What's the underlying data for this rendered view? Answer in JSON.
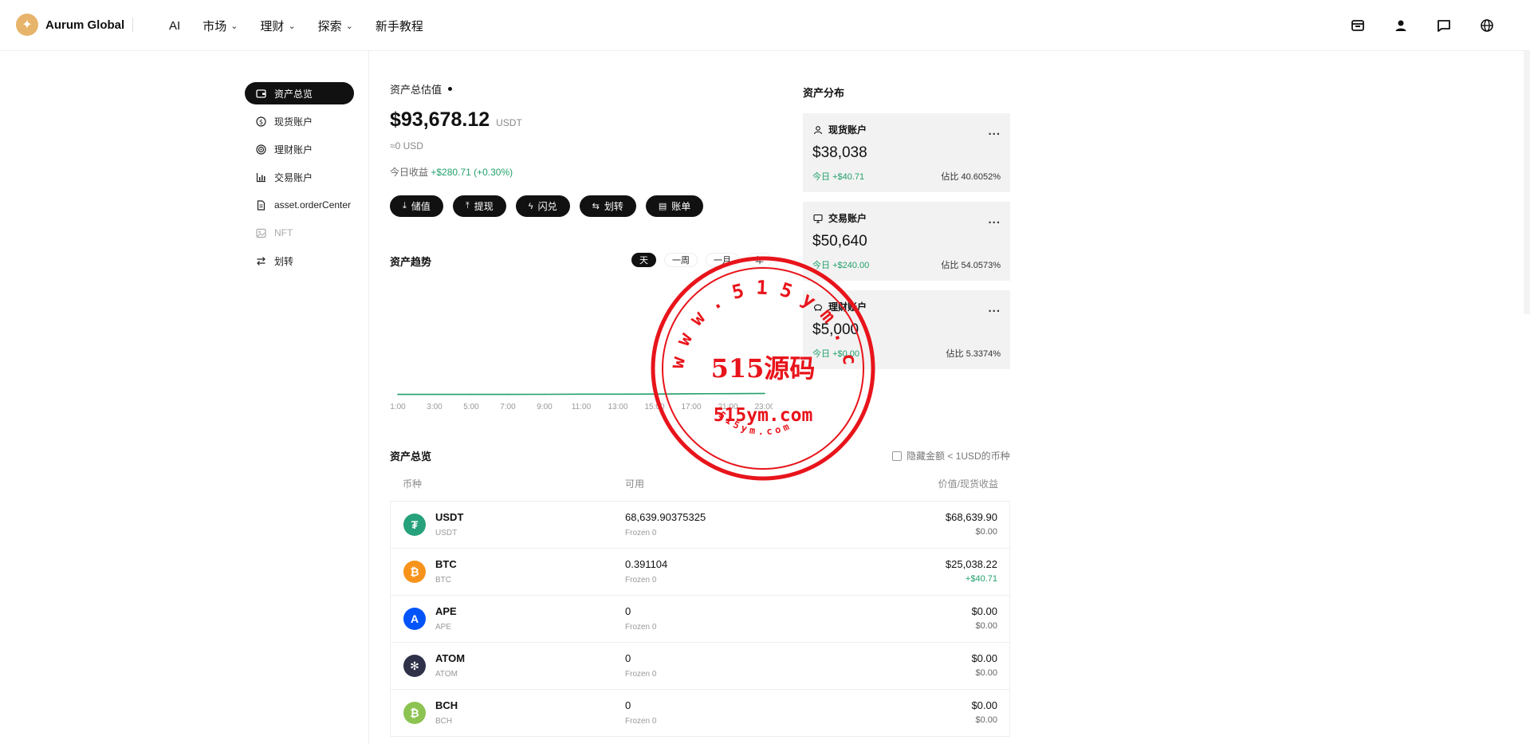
{
  "header": {
    "brand": "Aurum Global",
    "nav": [
      {
        "label": "AI",
        "dropdown": false
      },
      {
        "label": "市场",
        "dropdown": true
      },
      {
        "label": "理财",
        "dropdown": true
      },
      {
        "label": "探索",
        "dropdown": true
      },
      {
        "label": "新手教程",
        "dropdown": false
      }
    ],
    "icons": [
      "wallet-icon",
      "user-icon",
      "message-icon",
      "globe-icon"
    ]
  },
  "sidebar": {
    "items": [
      {
        "label": "资产总览",
        "icon": "wallet-icon",
        "state": "active"
      },
      {
        "label": "现货账户",
        "icon": "dollar-icon",
        "state": "normal"
      },
      {
        "label": "理财账户",
        "icon": "target-icon",
        "state": "normal"
      },
      {
        "label": "交易账户",
        "icon": "bar-chart-icon",
        "state": "normal"
      },
      {
        "label": "asset.orderCenter",
        "icon": "document-icon",
        "state": "normal"
      },
      {
        "label": "NFT",
        "icon": "image-icon",
        "state": "disabled"
      },
      {
        "label": "划转",
        "icon": "transfer-icon",
        "state": "normal"
      }
    ]
  },
  "summary": {
    "label": "资产总估值",
    "total": "$93,678.12",
    "unit": "USDT",
    "approx": "≈0 USD",
    "pnl_label": "今日收益",
    "pnl_value": "+$280.71",
    "pnl_percent": "(+0.30%)"
  },
  "actions": [
    {
      "label": "储值",
      "icon": "download-icon",
      "glyph": "⤓"
    },
    {
      "label": "提现",
      "icon": "upload-icon",
      "glyph": "⤒"
    },
    {
      "label": "闪兑",
      "icon": "flash-icon",
      "glyph": "ϟ"
    },
    {
      "label": "划转",
      "icon": "transfer-icon",
      "glyph": "⇆"
    },
    {
      "label": "账单",
      "icon": "bill-icon",
      "glyph": "▤"
    }
  ],
  "trend": {
    "title": "资产趋势",
    "ranges": [
      "天",
      "一周",
      "一月",
      "年"
    ],
    "active_range": "天"
  },
  "chart_data": {
    "type": "line",
    "x": [
      "1:00",
      "3:00",
      "5:00",
      "7:00",
      "9:00",
      "11:00",
      "13:00",
      "15:00",
      "17:00",
      "21:00",
      "23:00"
    ],
    "series": [
      {
        "values": [
          0.3,
          0.3,
          0.3,
          0.3,
          0.4,
          0.5,
          0.5,
          0.6,
          0.9,
          1.0,
          1.2
        ],
        "color": "#22a06b"
      }
    ],
    "title": "",
    "xlabel": "",
    "ylabel": "",
    "ylim": [
      0,
      100
    ],
    "grid": false
  },
  "distribution": {
    "title": "资产分布",
    "cards": [
      {
        "name": "现货账户",
        "icon": "user-icon",
        "value": "$38,038",
        "today_label": "今日",
        "today": "+$40.71",
        "share": "佔比 40.6052%"
      },
      {
        "name": "交易账户",
        "icon": "monitor-icon",
        "value": "$50,640",
        "today_label": "今日",
        "today": "+$240.00",
        "share": "佔比 54.0573%"
      },
      {
        "name": "理财账户",
        "icon": "piggy-icon",
        "value": "$5,000",
        "today_label": "今日",
        "today": "+$0.00",
        "share": "佔比 5.3374%"
      }
    ],
    "more": "..."
  },
  "overview": {
    "title": "资产总览",
    "hide_small": "隐藏金额 < 1USD的币种",
    "columns": [
      "币种",
      "可用",
      "价值/现货收益"
    ],
    "rows": [
      {
        "symbol": "USDT",
        "sub": "USDT",
        "available": "68,639.90375325",
        "frozen": "Frozen 0",
        "value": "$68,639.90",
        "pnl": "$0.00",
        "pnl_positive": false,
        "color": "#26a17b",
        "glyph": "₮"
      },
      {
        "symbol": "BTC",
        "sub": "BTC",
        "available": "0.391104",
        "frozen": "Frozen 0",
        "value": "$25,038.22",
        "pnl": "+$40.71",
        "pnl_positive": true,
        "color": "#f7931a",
        "glyph": "₿"
      },
      {
        "symbol": "APE",
        "sub": "APE",
        "available": "0",
        "frozen": "Frozen 0",
        "value": "$0.00",
        "pnl": "$0.00",
        "pnl_positive": false,
        "color": "#0054f9",
        "glyph": "A"
      },
      {
        "symbol": "ATOM",
        "sub": "ATOM",
        "available": "0",
        "frozen": "Frozen 0",
        "value": "$0.00",
        "pnl": "$0.00",
        "pnl_positive": false,
        "color": "#2e3148",
        "glyph": "✻"
      },
      {
        "symbol": "BCH",
        "sub": "BCH",
        "available": "0",
        "frozen": "Frozen 0",
        "value": "$0.00",
        "pnl": "$0.00",
        "pnl_positive": false,
        "color": "#8dc351",
        "glyph": "₿"
      }
    ]
  },
  "watermark": {
    "center": "515源码",
    "url": "515ym.com",
    "ring_top": "www.515ym.com",
    "ring_bottom": "515ym.com",
    "color": "#e8141b"
  }
}
